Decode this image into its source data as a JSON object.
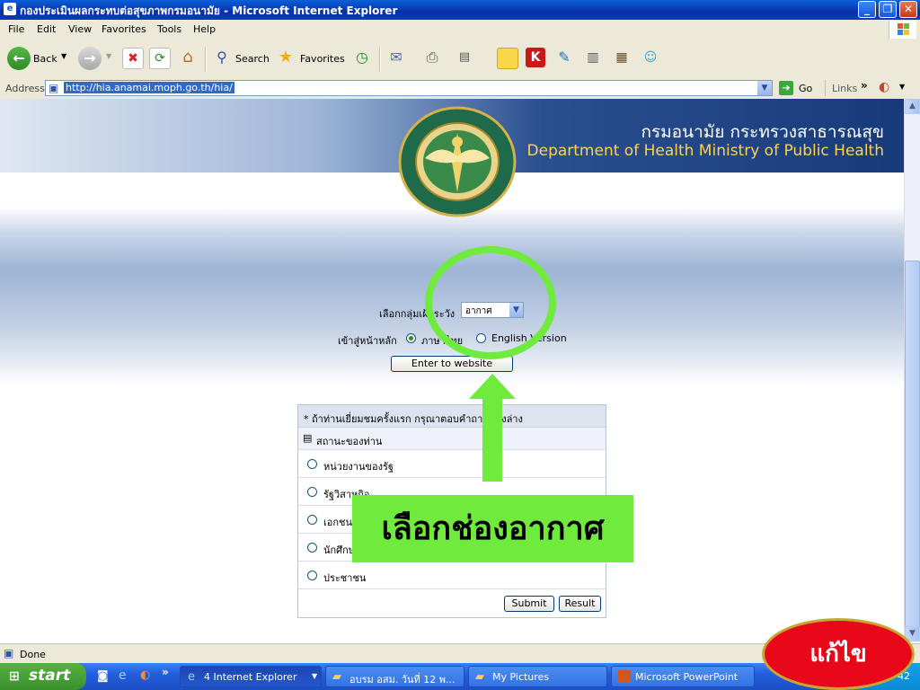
{
  "window": {
    "title": "กองประเมินผลกระทบต่อสุขภาพกรมอนามัย - Microsoft Internet Explorer"
  },
  "menu": [
    "File",
    "Edit",
    "View",
    "Favorites",
    "Tools",
    "Help"
  ],
  "toolbar": {
    "back": "Back",
    "search": "Search",
    "favorites": "Favorites"
  },
  "address": {
    "label": "Address",
    "url": "http://hia.anamai.moph.go.th/hia/",
    "go": "Go",
    "links": "Links"
  },
  "banner": {
    "thai": "กรมอนามัย กระทรวงสาธารณสุข",
    "english": "Department of Health Ministry of Public Health"
  },
  "page": {
    "group_label": "เลือกกลุ่มเฝ้าระวัง",
    "group_selected": "อากาศ",
    "lang_label": "เข้าสู่หน้าหลัก",
    "lang_thai": "ภาษาไทย",
    "lang_english": "English Version",
    "enter_button": "Enter to website"
  },
  "survey": {
    "note": "* ถ้าท่านเยี่ยมชมครั้งแรก กรุณาตอบคำถามข้างล่าง",
    "heading": "สถานะของท่าน",
    "options": [
      "หน่วยงานของรัฐ",
      "รัฐวิสาหกิจ",
      "เอกชน",
      "นักศึกษา",
      "ประชาชน"
    ],
    "submit": "Submit",
    "result": "Result"
  },
  "annotation": {
    "label": "เลือกช่องอากาศ",
    "color": "#6fea3d"
  },
  "status": {
    "text": "Done"
  },
  "taskbar": {
    "start": "start",
    "tasks": [
      "4 Internet Explorer",
      "อบรม อสม. วันที่ 12 พ...",
      "My Pictures",
      "Microsoft PowerPoint"
    ],
    "clock": "42"
  },
  "edit_button": "แก้ไข"
}
